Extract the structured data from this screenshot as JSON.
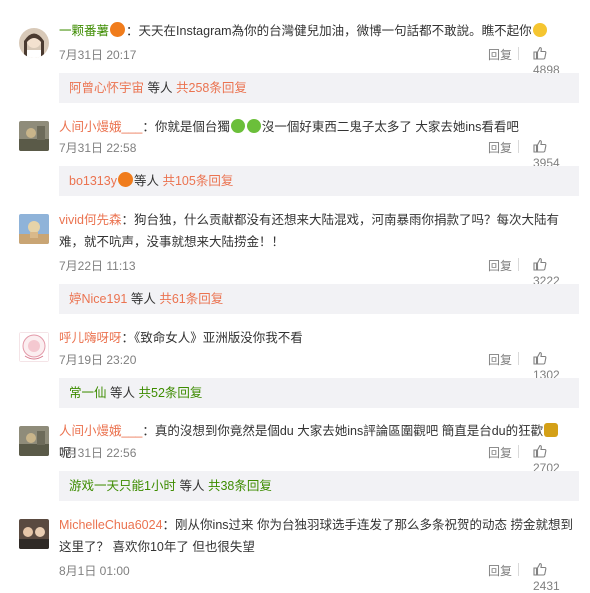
{
  "accent_color": "#eb7350",
  "icons": {
    "reply_sep": "divider",
    "like": "thumb-up-icon"
  },
  "comments": [
    {
      "user": "一颗番薯",
      "text": "：天天在Instagram為你的台灣健兒加油，微博一句話都不敢說。瞧不起你",
      "time": "7月31日 20:17",
      "reply": "回复",
      "likes": "4898",
      "more": {
        "who": "阿曾心怀宇宙",
        "mid": "等人",
        "count": "共258条回复"
      }
    },
    {
      "user": "人间小熳娥___",
      "text_a": "：你就是個台獨",
      "text_b": "沒一個好東西二鬼子太多了 大家去她ins看看吧",
      "time": "7月31日 22:58",
      "reply": "回复",
      "likes": "3954",
      "more": {
        "who": "bo1313y",
        "mid": "等人",
        "count": "共105条回复"
      }
    },
    {
      "user": "vivid何先森",
      "text": "：狗台独，什么贡献都没有还想来大陆混戏，河南暴雨你捐款了吗？每次大陆有难，就不吭声，没事就想来大陆捞金！！",
      "time": "7月22日 11:13",
      "reply": "回复",
      "likes": "3222",
      "more": {
        "who": "婷Nice191",
        "mid": "等人",
        "count": "共61条回复"
      }
    },
    {
      "user": "呼儿嗨呀呀",
      "text": "：《致命女人》亚洲版没你我不看",
      "time": "7月19日 23:20",
      "reply": "回复",
      "likes": "1302",
      "more": {
        "who": "常一仙",
        "mid": "等人",
        "count": "共52条回复"
      }
    },
    {
      "user": "人间小熳娥___",
      "text_a": "：真的沒想到你竟然是個du 大家去她ins評論區圍觀吧 簡直是台du的狂歡",
      "text_b": "呢！",
      "time": "7月31日 22:56",
      "reply": "回复",
      "likes": "2702",
      "more": {
        "who": "游戏一天只能1小时",
        "mid": "等人",
        "count": "共38条回复"
      }
    },
    {
      "user": "MichelleChua6024",
      "text": "：刚从你ins过来 你为台独羽球选手连发了那么多条祝贺的动态 捞金就想到这里了？ 喜欢你10年了 但也很失望",
      "time": "8月1日 01:00",
      "reply": "回复",
      "likes": "2431"
    }
  ]
}
